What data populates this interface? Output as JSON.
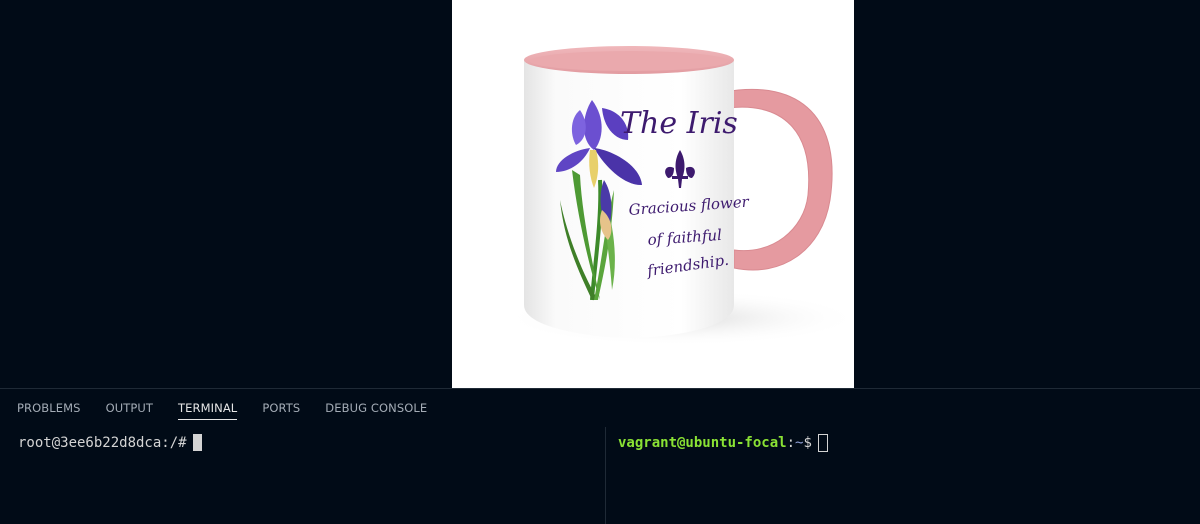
{
  "preview": {
    "image": {
      "title_text": "The Iris",
      "caption_lines": [
        "Gracious flower",
        "of faithful",
        "friendship."
      ],
      "colors": {
        "mug_rim": "#e8a4a8",
        "handle": "#e59aa0",
        "text": "#3d1a6e",
        "petal": "#5a3fb8",
        "stem": "#3d8a2a"
      }
    }
  },
  "panel": {
    "tabs": [
      {
        "label": "PROBLEMS",
        "active": false
      },
      {
        "label": "OUTPUT",
        "active": false
      },
      {
        "label": "TERMINAL",
        "active": true
      },
      {
        "label": "PORTS",
        "active": false
      },
      {
        "label": "DEBUG CONSOLE",
        "active": false
      }
    ],
    "terminal_left": {
      "prompt": "root@3ee6b22d8dca:/#"
    },
    "terminal_right": {
      "user_host": "vagrant@ubuntu-focal",
      "path_sep": ":",
      "path": "~",
      "symbol": "$"
    }
  }
}
